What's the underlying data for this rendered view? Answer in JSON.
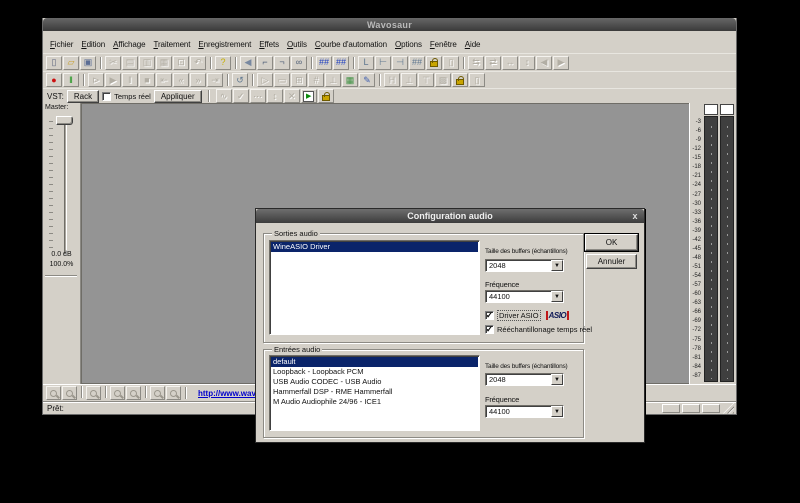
{
  "misc": {
    "check": "✓",
    "dropdown": "▼"
  },
  "colors": {
    "selection": "#0a246a",
    "link": "#0000cc",
    "record": "#cc1010",
    "lock": "#c8a400",
    "asio_red": "#c01818",
    "asio_navy": "#101a58"
  },
  "window": {
    "title": "Wavosaur",
    "menu": [
      "Fichier",
      "Edition",
      "Affichage",
      "Traitement",
      "Enregistrement",
      "Effets",
      "Outils",
      "Courbe d'automation",
      "Options",
      "Fenêtre",
      "Aide"
    ],
    "toolbar_main": [
      {
        "n": "new-file",
        "g": "▯",
        "c": "#606880"
      },
      {
        "n": "open-folder",
        "g": "▱",
        "c": "#c8a030"
      },
      {
        "n": "save",
        "g": "▣",
        "c": "#5a6c94"
      },
      {
        "sep": 1
      },
      {
        "n": "cut",
        "g": "✂",
        "d": 1
      },
      {
        "n": "copy",
        "g": "▤",
        "d": 1
      },
      {
        "n": "paste",
        "g": "▥",
        "d": 1
      },
      {
        "n": "paste-new",
        "g": "▦",
        "d": 1
      },
      {
        "n": "crop",
        "g": "⊡",
        "d": 1
      },
      {
        "n": "undo",
        "g": "↶",
        "d": 1
      },
      {
        "sep": 1
      },
      {
        "n": "help",
        "g": "?",
        "c": "#c8b000"
      },
      {
        "sep": 1
      },
      {
        "n": "speaker",
        "g": "◀",
        "c": "#7888a0"
      },
      {
        "n": "connector",
        "g": "⌐",
        "c": "#506078"
      },
      {
        "n": "connector-alt",
        "g": "¬",
        "c": "#506078"
      },
      {
        "n": "chain-link",
        "g": "∞",
        "c": "#506078"
      },
      {
        "sep": 1
      },
      {
        "n": "marker-pair-1",
        "g": "##",
        "c": "#2040c0"
      },
      {
        "n": "marker-pair-2",
        "g": "##",
        "c": "#2040c0"
      },
      {
        "sep": 1
      },
      {
        "n": "marker-l",
        "g": "L",
        "c": "#607890"
      },
      {
        "n": "marker-start",
        "g": "⊢",
        "c": "#607890"
      },
      {
        "n": "marker-end",
        "g": "⊣",
        "c": "#607890"
      },
      {
        "n": "markers-all",
        "g": "##",
        "c": "#607890"
      },
      {
        "n": "lock-markers",
        "s": "lock"
      },
      {
        "n": "delete-marker",
        "g": "▯",
        "d": 1
      },
      {
        "sep": 1
      },
      {
        "n": "swap-left",
        "g": "⇆",
        "d": 1
      },
      {
        "n": "swap-right",
        "g": "⇄",
        "d": 1
      },
      {
        "n": "expand",
        "g": "↔",
        "d": 1
      },
      {
        "n": "fit",
        "g": "↕",
        "d": 1
      },
      {
        "n": "prev",
        "g": "◀",
        "d": 1
      },
      {
        "n": "next",
        "g": "▶",
        "d": 1
      }
    ],
    "toolbar_transport": [
      {
        "n": "record",
        "g": "●",
        "c": "#cc1010"
      },
      {
        "n": "monitor-input",
        "g": "‖",
        "c": "#109010"
      },
      {
        "sep": 1
      },
      {
        "n": "play-from-start",
        "g": "⊳",
        "d": 1
      },
      {
        "n": "play",
        "g": "▶",
        "d": 1
      },
      {
        "n": "pause",
        "g": "‖",
        "d": 1
      },
      {
        "n": "stop",
        "g": "■",
        "d": 1
      },
      {
        "n": "go-to-start",
        "g": "⇤",
        "d": 1
      },
      {
        "n": "rewind",
        "g": "«",
        "d": 1
      },
      {
        "n": "forward",
        "g": "»",
        "d": 1
      },
      {
        "n": "go-to-end",
        "g": "⇥",
        "d": 1
      },
      {
        "sep": 1
      },
      {
        "n": "loop",
        "g": "↺",
        "c": "#607890"
      },
      {
        "sep": 1
      },
      {
        "n": "paste-insert",
        "g": "▷",
        "d": 1
      },
      {
        "n": "envelope",
        "g": "▭",
        "d": 1
      },
      {
        "n": "copy-to-new",
        "g": "⊞",
        "d": 1
      },
      {
        "n": "filter",
        "g": "#",
        "d": 1
      },
      {
        "n": "normalize",
        "g": "⊥",
        "d": 1
      },
      {
        "n": "batch-grid",
        "g": "▦",
        "c": "#3c9040"
      },
      {
        "n": "pencil-edit",
        "g": "✎",
        "c": "#4060b0"
      },
      {
        "sep": 1
      },
      {
        "n": "marker-h",
        "g": "H",
        "d": 1
      },
      {
        "n": "marker-up",
        "g": "⊥",
        "d": 1
      },
      {
        "n": "marker-down",
        "g": "⊤",
        "d": 1
      },
      {
        "n": "block",
        "g": "▩",
        "d": 1
      },
      {
        "n": "lock-transport",
        "s": "lock"
      },
      {
        "n": "trash",
        "g": "▯",
        "d": 1
      }
    ],
    "vst": {
      "label": "VST:",
      "rack_label": "Rack",
      "realtime_label": "Temps réel",
      "realtime_checked": false,
      "apply_label": "Appliquer",
      "icons": [
        {
          "n": "vst-curve",
          "g": "∿",
          "d": 1
        },
        {
          "n": "vst-check",
          "g": "✓",
          "d": 1
        },
        {
          "n": "vst-more",
          "g": "⋯",
          "d": 1
        },
        {
          "n": "vst-updown",
          "g": "↕",
          "d": 1
        },
        {
          "n": "vst-remove",
          "g": "✕",
          "d": 1
        },
        {
          "n": "vst-play",
          "s": "playbox"
        },
        {
          "n": "vst-lock",
          "s": "lock"
        }
      ]
    },
    "master": {
      "label": "Master:",
      "db": "0.0 dB",
      "percent": "100.0%"
    },
    "meters": {
      "scale": [
        "-3",
        "-6",
        "-9",
        "-12",
        "-15",
        "-18",
        "-21",
        "-24",
        "-27",
        "-30",
        "-33",
        "-36",
        "-39",
        "-42",
        "-45",
        "-48",
        "-51",
        "-54",
        "-57",
        "-60",
        "-63",
        "-66",
        "-69",
        "-72",
        "-75",
        "-78",
        "-81",
        "-84",
        "-87"
      ]
    },
    "zoom_bar": {
      "icons": [
        {
          "n": "zoom-in",
          "s": "mag",
          "d": 1
        },
        {
          "n": "zoom-out",
          "s": "mag",
          "d": 1
        },
        {
          "sep": 1
        },
        {
          "n": "zoom-selection",
          "s": "mag",
          "d": 1
        },
        {
          "sep": 1
        },
        {
          "n": "zoom-all",
          "s": "mag",
          "d": 1
        },
        {
          "n": "zoom-vertical",
          "s": "mag",
          "d": 1
        },
        {
          "sep": 1
        },
        {
          "n": "zoom-horizontal-in",
          "s": "mag",
          "d": 1
        },
        {
          "n": "zoom-horizontal-out",
          "s": "mag",
          "d": 1
        }
      ],
      "link": "http://www.wavosaur.com"
    },
    "status": {
      "text": "Prêt:"
    }
  },
  "dialog": {
    "title": "Configuration audio",
    "close_glyph": "x",
    "ok_label": "OK",
    "cancel_label": "Annuler",
    "outputs": {
      "legend": "Sorties audio",
      "list": {
        "items": [
          "WineASIO Driver"
        ],
        "selected": 0
      },
      "buffer_label": "Taille des buffers (échantillons)",
      "buffer_value": "2048",
      "freq_label": "Fréquence",
      "freq_value": "44100",
      "driver_asio_label": "Driver ASIO",
      "driver_asio_checked": true,
      "asio_logo": "ASIO",
      "resample_label": "Rééchantillonage temps réel",
      "resample_checked": true
    },
    "inputs": {
      "legend": "Entrées audio",
      "list": {
        "items": [
          "default",
          "Loopback - Loopback PCM",
          "USB Audio CODEC - USB Audio",
          "Hammerfall DSP - RME Hammerfall",
          "M Audio Audiophile 24/96 - ICE1"
        ],
        "selected": 0
      },
      "buffer_label": "Taille des buffers (échantillons)",
      "buffer_value": "2048",
      "freq_label": "Fréquence",
      "freq_value": "44100"
    }
  }
}
